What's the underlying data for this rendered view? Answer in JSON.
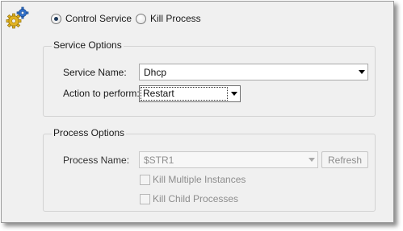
{
  "mode": {
    "options": [
      {
        "label": "Control Service",
        "checked": true
      },
      {
        "label": "Kill Process",
        "checked": false
      }
    ]
  },
  "service_options": {
    "title": "Service Options",
    "service_name_label": "Service Name:",
    "service_name_value": "Dhcp",
    "action_label": "Action to perform:",
    "action_value": "Restart"
  },
  "process_options": {
    "title": "Process Options",
    "process_name_label": "Process Name:",
    "process_name_value": "$STR1",
    "refresh_label": "Refresh",
    "kill_multiple_label": "Kill Multiple Instances",
    "kill_multiple_checked": false,
    "kill_child_label": "Kill Child Processes",
    "kill_child_checked": false
  },
  "colors": {
    "panel_bg": "#f0f0f0",
    "gear_gold": "#e2b322",
    "gear_blue": "#2f6fc9",
    "disabled_text": "#8d8d8d"
  },
  "icons": {
    "app": "gears-icon",
    "dropdown": "chevron-down-icon"
  }
}
